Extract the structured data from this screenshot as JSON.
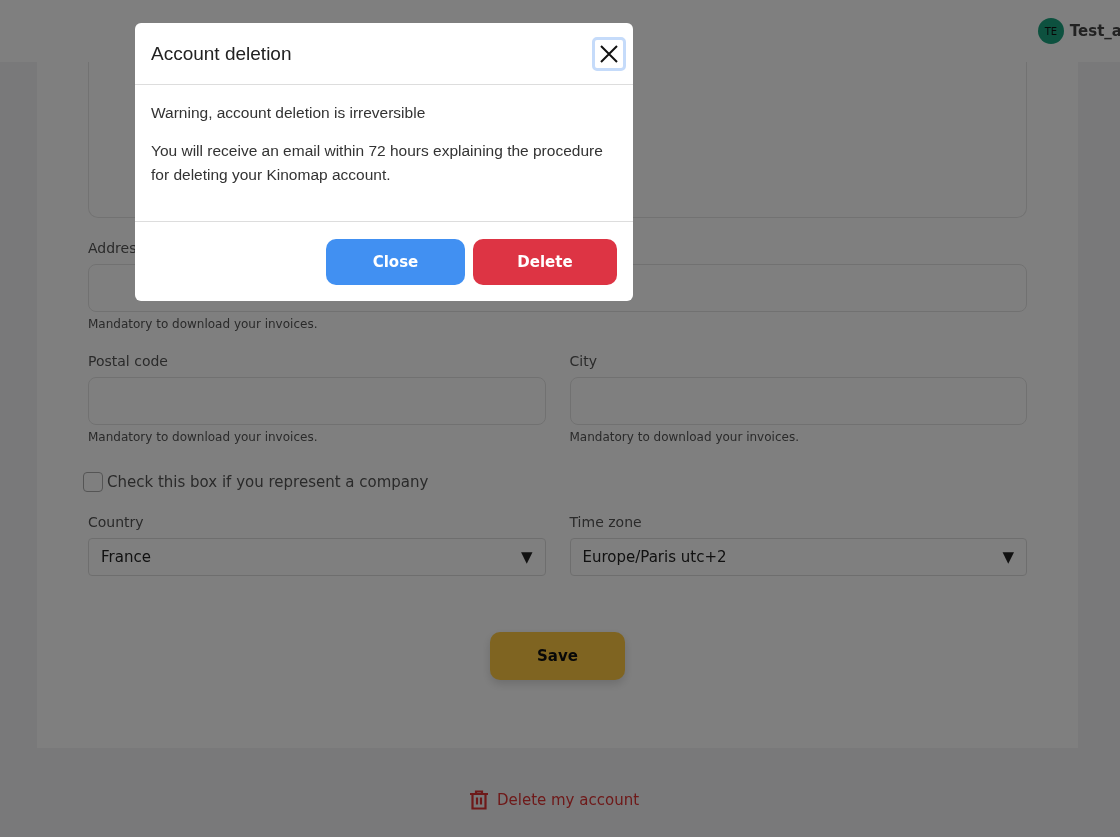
{
  "header": {
    "avatar": "TE",
    "username": "Test_a"
  },
  "form": {
    "address": {
      "label": "Addres",
      "hint": "Mandatory to download your invoices."
    },
    "postal_code": {
      "label": "Postal code",
      "hint": "Mandatory to download your invoices."
    },
    "city": {
      "label": "City",
      "hint": "Mandatory to download your invoices."
    },
    "company_checkbox": {
      "label": "Check this box if you represent a company",
      "checked": false
    },
    "country": {
      "label": "Country",
      "value": "France",
      "arrow": "▼"
    },
    "time_zone": {
      "label": "Time zone",
      "value": "Europe/Paris utc+2",
      "arrow": "▼"
    },
    "save_button": "Save"
  },
  "delete_link": "Delete my account",
  "dialog": {
    "title": "Account deletion",
    "warning": "Warning, account deletion is irreversible",
    "message": "You will receive an email within 72 hours explaining the procedure for deleting your Kinomap account.",
    "buttons": [
      {
        "label": "Close",
        "kind": "secondary"
      },
      {
        "label": "Delete",
        "kind": "danger"
      }
    ]
  }
}
